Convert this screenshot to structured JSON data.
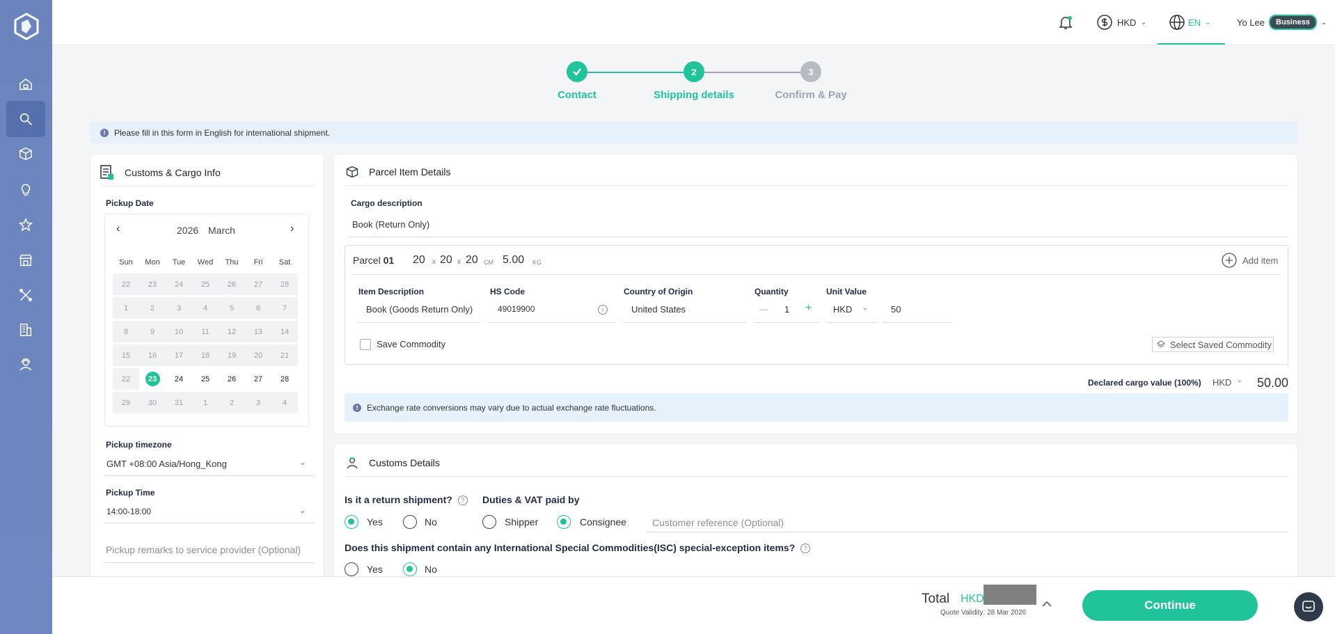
{
  "header": {
    "currency": "HKD",
    "language": "EN",
    "user_name": "Yo Lee",
    "user_badge": "Business"
  },
  "stepper": {
    "steps": [
      {
        "label": "Contact",
        "number": "",
        "state": "done"
      },
      {
        "label": "Shipping details",
        "number": "2",
        "state": "active"
      },
      {
        "label": "Confirm & Pay",
        "number": "3",
        "state": "pending"
      }
    ]
  },
  "banner": {
    "text": "Please fill in this form in English for international shipment."
  },
  "customs_cargo": {
    "title": "Customs & Cargo Info",
    "pickup_date_label": "Pickup Date",
    "calendar": {
      "year": "2026",
      "month": "March",
      "prev": "‹",
      "next": "›",
      "weekdays": [
        "Sun",
        "Mon",
        "Tue",
        "Wed",
        "Thu",
        "Fri",
        "Sat"
      ],
      "selected": "23",
      "rows": [
        [
          "22",
          "23",
          "24",
          "25",
          "26",
          "27",
          "28"
        ],
        [
          "1",
          "2",
          "3",
          "4",
          "5",
          "6",
          "7"
        ],
        [
          "8",
          "9",
          "10",
          "11",
          "12",
          "13",
          "14"
        ],
        [
          "15",
          "16",
          "17",
          "18",
          "19",
          "20",
          "21"
        ],
        [
          "22",
          "23",
          "24",
          "25",
          "26",
          "27",
          "28"
        ],
        [
          "29",
          "30",
          "31",
          "1",
          "2",
          "3",
          "4"
        ]
      ]
    },
    "timezone_label": "Pickup timezone",
    "timezone_value": "GMT +08:00 Asia/Hong_Kong",
    "time_label": "Pickup Time",
    "time_value": "14:00-18:00",
    "remarks_placeholder": "Pickup remarks to service provider (Optional)"
  },
  "parcel": {
    "title": "Parcel Item Details",
    "cargo_label": "Cargo description",
    "cargo_value": "Book (Return Only)",
    "parcel_label": "Parcel",
    "parcel_number": "01",
    "dim_l": "20",
    "dim_w": "20",
    "dim_h": "20",
    "x": "x",
    "dim_unit": "CM",
    "weight": "5.00",
    "weight_unit": "KG",
    "add_item": "Add item",
    "columns": {
      "item_desc": "Item Description",
      "hs_code": "HS Code",
      "origin": "Country of Origin",
      "quantity": "Quantity",
      "unit_value": "Unit Value"
    },
    "item": {
      "desc": "Book (Goods Return Only)",
      "hs_code": "49019900",
      "origin": "United States",
      "qty_minus": "—",
      "qty": "1",
      "qty_plus": "+",
      "currency": "HKD",
      "value": "50"
    },
    "save_commodity": "Save Commodity",
    "select_saved": "Select Saved Commodity",
    "declared_label": "Declared cargo value (100%)",
    "declared_currency": "HKD",
    "declared_value": "50.00",
    "exchange_note": "Exchange rate conversions may vary due to actual exchange rate fluctuations."
  },
  "customs": {
    "title": "Customs Details",
    "q_return": "Is it a return shipment?",
    "q_duties": "Duties & VAT paid by",
    "yes": "Yes",
    "no": "No",
    "shipper": "Shipper",
    "consignee": "Consignee",
    "reference_placeholder": "Customer reference (Optional)",
    "q_isc": "Does this shipment contain any International Special Commodities(ISC) special-exception items?"
  },
  "footer": {
    "total_label": "Total",
    "total_currency": "HKD",
    "validity": "Quote Validity: 28 Mar 2026",
    "continue": "Continue"
  },
  "colors": {
    "accent": "#21c49a",
    "sidebar": "#6b84be",
    "navy": "#1f2a44"
  }
}
